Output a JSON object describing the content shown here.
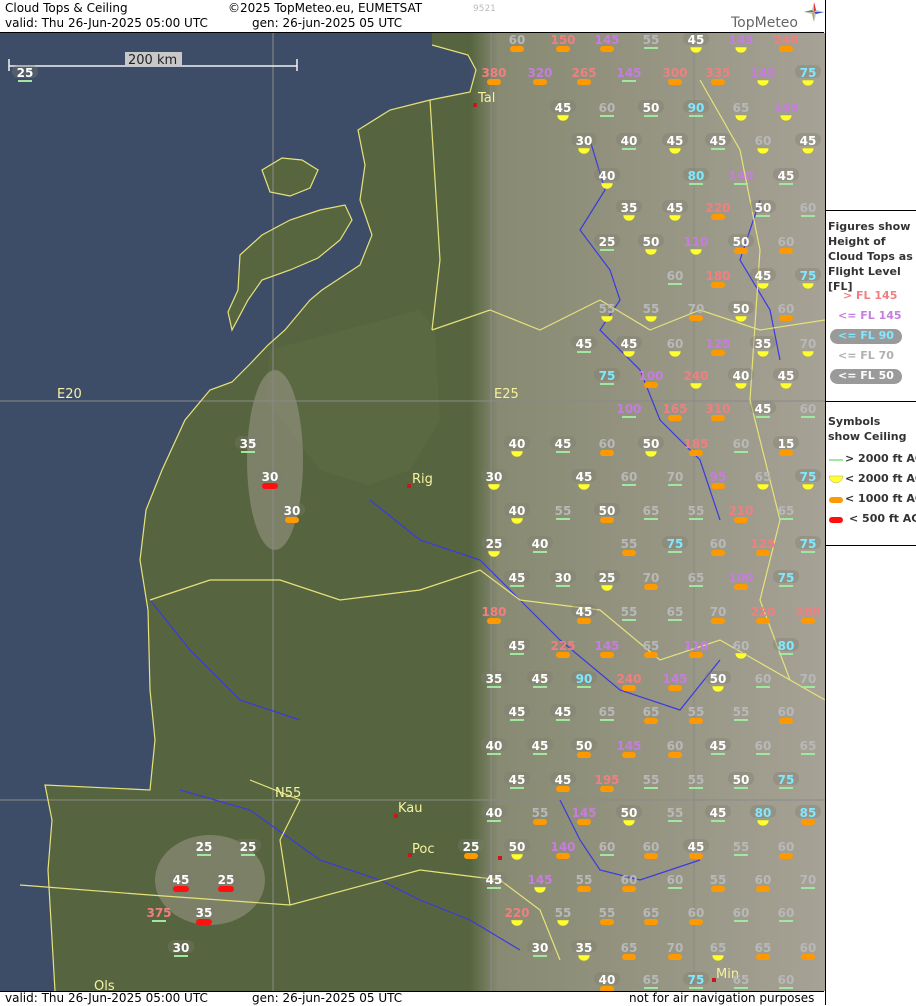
{
  "header": {
    "title": "Cloud Tops & Ceiling",
    "copyright": "©2025 TopMeteo.eu, EUMETSAT",
    "valid": "valid:  Thu  26-Jun-2025  05:00 UTC",
    "gen": "gen: 26-jun-2025 05 UTC",
    "id": "9521",
    "logo": "TopMeteo"
  },
  "footer": {
    "valid": "valid:  Thu  26-Jun-2025  05:00 UTC",
    "gen": "gen: 26-jun-2025 05 UTC",
    "disclaimer": "not for air navigation purposes"
  },
  "map": {
    "scale_label": "200 km",
    "grid_labels": [
      "E20",
      "E25",
      "N55"
    ],
    "places": [
      "Tal",
      "Rig",
      "Kau",
      "Poc",
      "Min",
      "Ols"
    ]
  },
  "legend": {
    "tops_title": "Figures show Height of Cloud Tops as Flight Level  [FL]",
    "tops": [
      {
        "label": "> FL 145",
        "color": "#f08080"
      },
      {
        "label": "<= FL 145",
        "color": "#c77ddf"
      },
      {
        "label": "<= FL 90",
        "color": "#80e8ff"
      },
      {
        "label": "<= FL 70",
        "color": "#b0b0b0"
      },
      {
        "label": "<= FL 50",
        "color": "#ffffff"
      }
    ],
    "ceiling_title": "Symbols show Ceiling",
    "ceiling": [
      {
        "label": "> 2000 ft AGL",
        "symbol": "green-line",
        "color": "#a0e8a0"
      },
      {
        "label": "< 2000 ft AGL",
        "symbol": "yellow-half-disc",
        "color": "#ffff30"
      },
      {
        "label": "< 1000 ft AGL",
        "symbol": "orange-bar",
        "color": "#ff9900"
      },
      {
        "label": "< 500 ft AGL",
        "symbol": "red-bar",
        "color": "#ff1010"
      }
    ]
  },
  "colors": {
    "tops_hi": "#f08080",
    "tops_145": "#c77ddf",
    "tops_90": "#80e8ff",
    "tops_70": "#b8b8b8",
    "tops_50": "#ffffff",
    "sym_g": "#a0e8a0",
    "sym_y": "#ffff30",
    "sym_o": "#ff9900",
    "sym_r": "#ff1010"
  },
  "observations": [
    [
      "60",
      "o",
      "70",
      "g"
    ],
    [
      "150",
      "o",
      "hi",
      "g"
    ],
    [
      "145",
      "o",
      "145",
      "g"
    ],
    [
      "55",
      "g",
      "70",
      "g"
    ],
    [
      "45",
      "y",
      "50",
      "g"
    ],
    [
      "145",
      "y",
      "145",
      "g"
    ],
    [
      "240",
      "o",
      "hi",
      "g"
    ],
    [
      "25",
      "g",
      "50",
      "g"
    ],
    [
      "380",
      "o",
      "hi",
      "g"
    ],
    [
      "320",
      "o",
      "145",
      "g"
    ],
    [
      "265",
      "o",
      "hi",
      "g"
    ],
    [
      "145",
      "g",
      "145",
      "g"
    ],
    [
      "300",
      "o",
      "hi",
      "g"
    ],
    [
      "335",
      "o",
      "hi",
      "g"
    ],
    [
      "145",
      "y",
      "145",
      "g"
    ],
    [
      "75",
      "y",
      "90",
      "g"
    ],
    [
      "45",
      "y",
      "50",
      "g"
    ],
    [
      "60",
      "g",
      "70",
      "g"
    ],
    [
      "50",
      "g",
      "50",
      "g"
    ],
    [
      "90",
      "g",
      "90",
      "g"
    ],
    [
      "65",
      "y",
      "70",
      "g"
    ],
    [
      "145",
      "y",
      "145",
      "g"
    ],
    [
      "30",
      "y",
      "50",
      "g"
    ],
    [
      "40",
      "g",
      "50",
      "g"
    ],
    [
      "45",
      "y",
      "50",
      "g"
    ],
    [
      "45",
      "g",
      "50",
      "g"
    ],
    [
      "60",
      "y",
      "70",
      "g"
    ],
    [
      "45",
      "y",
      "50",
      "g"
    ],
    [
      "40",
      "y",
      "50",
      "g"
    ],
    [
      "80",
      "g",
      "90",
      "g"
    ],
    [
      "140",
      "g",
      "145",
      "g"
    ],
    [
      "45",
      "g",
      "50",
      "g"
    ],
    [
      "35",
      "y",
      "50",
      "g"
    ],
    [
      "45",
      "y",
      "50",
      "g"
    ],
    [
      "220",
      "o",
      "hi",
      "g"
    ],
    [
      "50",
      "g",
      "50",
      "g"
    ],
    [
      "60",
      "g",
      "70",
      "g"
    ],
    [
      "25",
      "g",
      "50",
      "g"
    ],
    [
      "50",
      "y",
      "50",
      "g"
    ],
    [
      "110",
      "y",
      "145",
      "g"
    ],
    [
      "50",
      "o",
      "50",
      "g"
    ],
    [
      "60",
      "o",
      "70",
      "g"
    ],
    [
      "60",
      "g",
      "70",
      "g"
    ],
    [
      "180",
      "o",
      "hi",
      "g"
    ],
    [
      "45",
      "y",
      "50",
      "g"
    ],
    [
      "75",
      "y",
      "90",
      "g"
    ],
    [
      "55",
      "y",
      "70",
      "g"
    ],
    [
      "55",
      "y",
      "70",
      "g"
    ],
    [
      "70",
      "o",
      "70",
      "g"
    ],
    [
      "50",
      "y",
      "50",
      "g"
    ],
    [
      "60",
      "o",
      "70",
      "g"
    ],
    [
      "45",
      "g",
      "50",
      "g"
    ],
    [
      "45",
      "y",
      "50",
      "g"
    ],
    [
      "60",
      "y",
      "70",
      "g"
    ],
    [
      "125",
      "o",
      "145",
      "g"
    ],
    [
      "35",
      "y",
      "50",
      "g"
    ],
    [
      "70",
      "y",
      "70",
      "g"
    ],
    [
      "75",
      "g",
      "90",
      "g"
    ],
    [
      "100",
      "o",
      "145",
      "g"
    ],
    [
      "240",
      "y",
      "hi",
      "g"
    ],
    [
      "40",
      "y",
      "50",
      "g"
    ],
    [
      "45",
      "y",
      "50",
      "g"
    ],
    [
      "100",
      "g",
      "145",
      "g"
    ],
    [
      "165",
      "o",
      "hi",
      "g"
    ],
    [
      "310",
      "o",
      "hi",
      "g"
    ],
    [
      "45",
      "g",
      "50",
      "g"
    ],
    [
      "60",
      "g",
      "70",
      "g"
    ],
    [
      "35",
      "g",
      "50",
      "g"
    ],
    [
      "40",
      "y",
      "50",
      "g"
    ],
    [
      "45",
      "g",
      "50",
      "g"
    ],
    [
      "60",
      "o",
      "70",
      "g"
    ],
    [
      "50",
      "y",
      "50",
      "g"
    ],
    [
      "185",
      "o",
      "hi",
      "g"
    ],
    [
      "60",
      "g",
      "70",
      "g"
    ],
    [
      "15",
      "o",
      "50",
      "g"
    ],
    [
      "30",
      "r",
      "50",
      "g"
    ],
    [
      "30",
      "y",
      "50",
      "g"
    ],
    [
      "45",
      "y",
      "50",
      "g"
    ],
    [
      "60",
      "g",
      "70",
      "g"
    ],
    [
      "70",
      "g",
      "70",
      "g"
    ],
    [
      "95",
      "o",
      "145",
      "g"
    ],
    [
      "65",
      "y",
      "70",
      "g"
    ],
    [
      "75",
      "y",
      "90",
      "g"
    ],
    [
      "30",
      "o",
      "50",
      "g"
    ],
    [
      "40",
      "y",
      "50",
      "g"
    ],
    [
      "55",
      "g",
      "70",
      "g"
    ],
    [
      "50",
      "o",
      "50",
      "g"
    ],
    [
      "65",
      "g",
      "70",
      "g"
    ],
    [
      "55",
      "g",
      "70",
      "g"
    ],
    [
      "210",
      "o",
      "hi",
      "g"
    ],
    [
      "65",
      "g",
      "70",
      "g"
    ],
    [
      "25",
      "y",
      "50",
      "g"
    ],
    [
      "40",
      "g",
      "50",
      "g"
    ],
    [
      "55",
      "o",
      "70",
      "g"
    ],
    [
      "75",
      "g",
      "90",
      "g"
    ],
    [
      "60",
      "o",
      "70",
      "g"
    ],
    [
      "125",
      "o",
      "hi",
      "g"
    ],
    [
      "75",
      "g",
      "90",
      "g"
    ],
    [
      "45",
      "g",
      "50",
      "g"
    ],
    [
      "30",
      "g",
      "50",
      "g"
    ],
    [
      "25",
      "y",
      "50",
      "g"
    ],
    [
      "70",
      "o",
      "70",
      "g"
    ],
    [
      "65",
      "g",
      "70",
      "g"
    ],
    [
      "100",
      "o",
      "145",
      "g"
    ],
    [
      "75",
      "g",
      "90",
      "g"
    ],
    [
      "180",
      "o",
      "hi",
      "g"
    ],
    [
      "45",
      "o",
      "50",
      "g"
    ],
    [
      "55",
      "g",
      "70",
      "g"
    ],
    [
      "65",
      "g",
      "70",
      "g"
    ],
    [
      "70",
      "o",
      "70",
      "g"
    ],
    [
      "220",
      "o",
      "hi",
      "g"
    ],
    [
      "280",
      "o",
      "hi",
      "g"
    ],
    [
      "45",
      "g",
      "50",
      "g"
    ],
    [
      "225",
      "o",
      "hi",
      "g"
    ],
    [
      "145",
      "o",
      "145",
      "g"
    ],
    [
      "65",
      "o",
      "70",
      "g"
    ],
    [
      "110",
      "o",
      "145",
      "g"
    ],
    [
      "60",
      "y",
      "70",
      "g"
    ],
    [
      "80",
      "g",
      "90",
      "g"
    ],
    [
      "35",
      "g",
      "50",
      "g"
    ],
    [
      "45",
      "g",
      "50",
      "g"
    ],
    [
      "90",
      "g",
      "90",
      "g"
    ],
    [
      "240",
      "o",
      "hi",
      "g"
    ],
    [
      "145",
      "o",
      "145",
      "g"
    ],
    [
      "50",
      "y",
      "50",
      "g"
    ],
    [
      "60",
      "g",
      "70",
      "g"
    ],
    [
      "70",
      "g",
      "70",
      "g"
    ],
    [
      "45",
      "g",
      "50",
      "g"
    ],
    [
      "45",
      "g",
      "50",
      "g"
    ],
    [
      "65",
      "g",
      "70",
      "g"
    ],
    [
      "65",
      "o",
      "70",
      "g"
    ],
    [
      "55",
      "o",
      "70",
      "g"
    ],
    [
      "55",
      "g",
      "70",
      "g"
    ],
    [
      "60",
      "o",
      "70",
      "g"
    ],
    [
      "40",
      "g",
      "50",
      "g"
    ],
    [
      "45",
      "g",
      "50",
      "g"
    ],
    [
      "50",
      "o",
      "50",
      "g"
    ],
    [
      "145",
      "o",
      "145",
      "g"
    ],
    [
      "60",
      "o",
      "70",
      "g"
    ],
    [
      "45",
      "g",
      "50",
      "g"
    ],
    [
      "60",
      "g",
      "70",
      "g"
    ],
    [
      "65",
      "g",
      "70",
      "g"
    ],
    [
      "45",
      "g",
      "50",
      "g"
    ],
    [
      "45",
      "o",
      "50",
      "g"
    ],
    [
      "195",
      "o",
      "hi",
      "g"
    ],
    [
      "55",
      "g",
      "70",
      "g"
    ],
    [
      "55",
      "g",
      "70",
      "g"
    ],
    [
      "50",
      "g",
      "50",
      "g"
    ],
    [
      "75",
      "g",
      "90",
      "g"
    ],
    [
      "40",
      "g",
      "50",
      "g"
    ],
    [
      "55",
      "o",
      "70",
      "g"
    ],
    [
      "145",
      "o",
      "145",
      "g"
    ],
    [
      "50",
      "y",
      "50",
      "g"
    ],
    [
      "55",
      "g",
      "70",
      "g"
    ],
    [
      "45",
      "g",
      "50",
      "g"
    ],
    [
      "80",
      "y",
      "90",
      "g"
    ],
    [
      "85",
      "o",
      "90",
      "g"
    ],
    [
      "25",
      "g",
      "50",
      "g"
    ],
    [
      "25",
      "g",
      "50",
      "g"
    ],
    [
      "25",
      "o",
      "50",
      "g"
    ],
    [
      "50",
      "y",
      "50",
      "g"
    ],
    [
      "140",
      "o",
      "145",
      "g"
    ],
    [
      "60",
      "g",
      "70",
      "g"
    ],
    [
      "60",
      "o",
      "70",
      "g"
    ],
    [
      "45",
      "o",
      "50",
      "g"
    ],
    [
      "55",
      "g",
      "70",
      "g"
    ],
    [
      "60",
      "o",
      "70",
      "g"
    ],
    [
      "45",
      "r",
      "50",
      "g"
    ],
    [
      "25",
      "r",
      "50",
      "g"
    ],
    [
      "45",
      "g",
      "50",
      "g"
    ],
    [
      "145",
      "y",
      "145",
      "g"
    ],
    [
      "55",
      "o",
      "70",
      "g"
    ],
    [
      "60",
      "o",
      "70",
      "g"
    ],
    [
      "60",
      "g",
      "70",
      "g"
    ],
    [
      "55",
      "o",
      "70",
      "g"
    ],
    [
      "60",
      "o",
      "70",
      "g"
    ],
    [
      "70",
      "g",
      "70",
      "g"
    ],
    [
      "375",
      "g",
      "hi",
      "g"
    ],
    [
      "35",
      "r",
      "50",
      "g"
    ],
    [
      "220",
      "y",
      "hi",
      "g"
    ],
    [
      "55",
      "y",
      "70",
      "g"
    ],
    [
      "55",
      "o",
      "70",
      "g"
    ],
    [
      "65",
      "o",
      "70",
      "g"
    ],
    [
      "60",
      "o",
      "70",
      "g"
    ],
    [
      "60",
      "g",
      "70",
      "g"
    ],
    [
      "60",
      "g",
      "70",
      "g"
    ],
    [
      "30",
      "g",
      "50",
      "g"
    ],
    [
      "30",
      "g",
      "50",
      "g"
    ],
    [
      "35",
      "y",
      "50",
      "g"
    ],
    [
      "65",
      "o",
      "70",
      "g"
    ],
    [
      "70",
      "o",
      "70",
      "g"
    ],
    [
      "65",
      "y",
      "70",
      "g"
    ],
    [
      "65",
      "o",
      "70",
      "g"
    ],
    [
      "60",
      "o",
      "70",
      "g"
    ],
    [
      "40",
      "o",
      "50",
      "g"
    ],
    [
      "65",
      "g",
      "70",
      "g"
    ],
    [
      "75",
      "g",
      "90",
      "g"
    ],
    [
      "65",
      "g",
      "70",
      "g"
    ],
    [
      "60",
      "g",
      "70",
      "g"
    ]
  ]
}
